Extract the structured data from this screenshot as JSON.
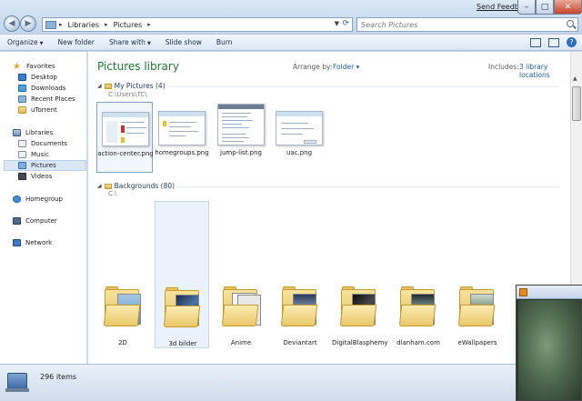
{
  "titlebar": {
    "send_feedback": "Send Feedback",
    "minimize_glyph": "–",
    "maximize_glyph": "□",
    "close_glyph": "✕"
  },
  "address": {
    "segments": [
      "Libraries",
      "Pictures"
    ],
    "separator": "▸"
  },
  "search": {
    "placeholder": "Search Pictures"
  },
  "toolbar": {
    "organize": "Organize",
    "new_folder": "New folder",
    "share_with": "Share with",
    "slide_show": "Slide show",
    "burn": "Burn",
    "help_glyph": "?"
  },
  "nav": {
    "favorites": "Favorites",
    "desktop": "Desktop",
    "downloads": "Downloads",
    "recent_places": "Recent Places",
    "utorrent": "uTorrent",
    "libraries": "Libraries",
    "documents": "Documents",
    "music": "Music",
    "pictures": "Pictures",
    "videos": "Videos",
    "homegroup": "Homegroup",
    "computer": "Computer",
    "network": "Network"
  },
  "content": {
    "library_title": "Pictures library",
    "arrange_label": "Arrange by:",
    "arrange_value": "Folder ▾",
    "includes_label": "Includes:",
    "includes_value": "3 library locations"
  },
  "group1": {
    "title": "My Pictures (4)",
    "path": "C:\\Users\\TC\\",
    "files": [
      "action-center.png",
      "homegroups.png",
      "jump-list.png",
      "uac.png"
    ]
  },
  "group2": {
    "title": "Backgrounds (80)",
    "path": "C:\\",
    "folders": [
      "2D",
      "3d bilder",
      "Anime",
      "Deviantart",
      "DigitalBlasphemy",
      "dlanham.com",
      "eWallpapers"
    ]
  },
  "details": {
    "count": "296 items"
  },
  "colors": {
    "library_title": "#1e7a35",
    "link": "#1f5ea8",
    "selection": "#dbe7f5",
    "close_button": "#c8442a"
  }
}
